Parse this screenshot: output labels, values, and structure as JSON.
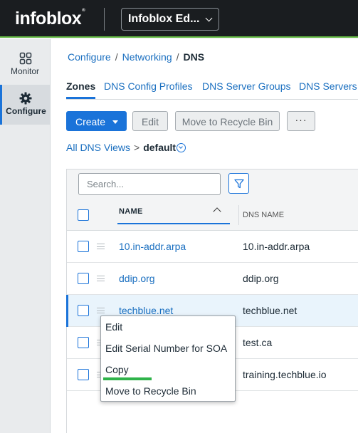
{
  "header": {
    "logo_text": "infoblox",
    "logo_tm": "®",
    "product_select": "Infoblox Ed..."
  },
  "sidebar": {
    "items": [
      {
        "label": "Monitor",
        "icon": "grid-icon"
      },
      {
        "label": "Configure",
        "icon": "gear-icon",
        "active": true
      }
    ]
  },
  "breadcrumb": {
    "items": [
      "Configure",
      "Networking",
      "DNS"
    ],
    "separator": "/"
  },
  "tabs": [
    {
      "label": "Zones",
      "active": true
    },
    {
      "label": "DNS Config Profiles"
    },
    {
      "label": "DNS Server Groups"
    },
    {
      "label": "DNS Servers"
    }
  ],
  "toolbar": {
    "create_label": "Create",
    "edit_label": "Edit",
    "recycle_label": "Move to Recycle Bin",
    "more_label": "···"
  },
  "views": {
    "all_label": "All DNS Views",
    "separator": ">",
    "current": "default"
  },
  "grid": {
    "search_placeholder": "Search...",
    "columns": [
      "NAME",
      "DNS NAME"
    ],
    "rows": [
      {
        "name": "10.in-addr.arpa",
        "dns_name": "10.in-addr.arpa"
      },
      {
        "name": "ddip.org",
        "dns_name": "ddip.org"
      },
      {
        "name": "techblue.net",
        "dns_name": "techblue.net",
        "selected": true
      },
      {
        "name": "",
        "dns_name": "test.ca"
      },
      {
        "name": "",
        "dns_name": "training.techblue.io"
      }
    ]
  },
  "context_menu": {
    "items": [
      "Edit",
      "Edit Serial Number for SOA",
      "Copy",
      "Move to Recycle Bin"
    ],
    "highlighted": "Copy"
  },
  "colors": {
    "accent": "#1a73d9",
    "brand_green": "#63b843",
    "highlight_green": "#2fb34a",
    "topbar": "#1a1d20"
  }
}
